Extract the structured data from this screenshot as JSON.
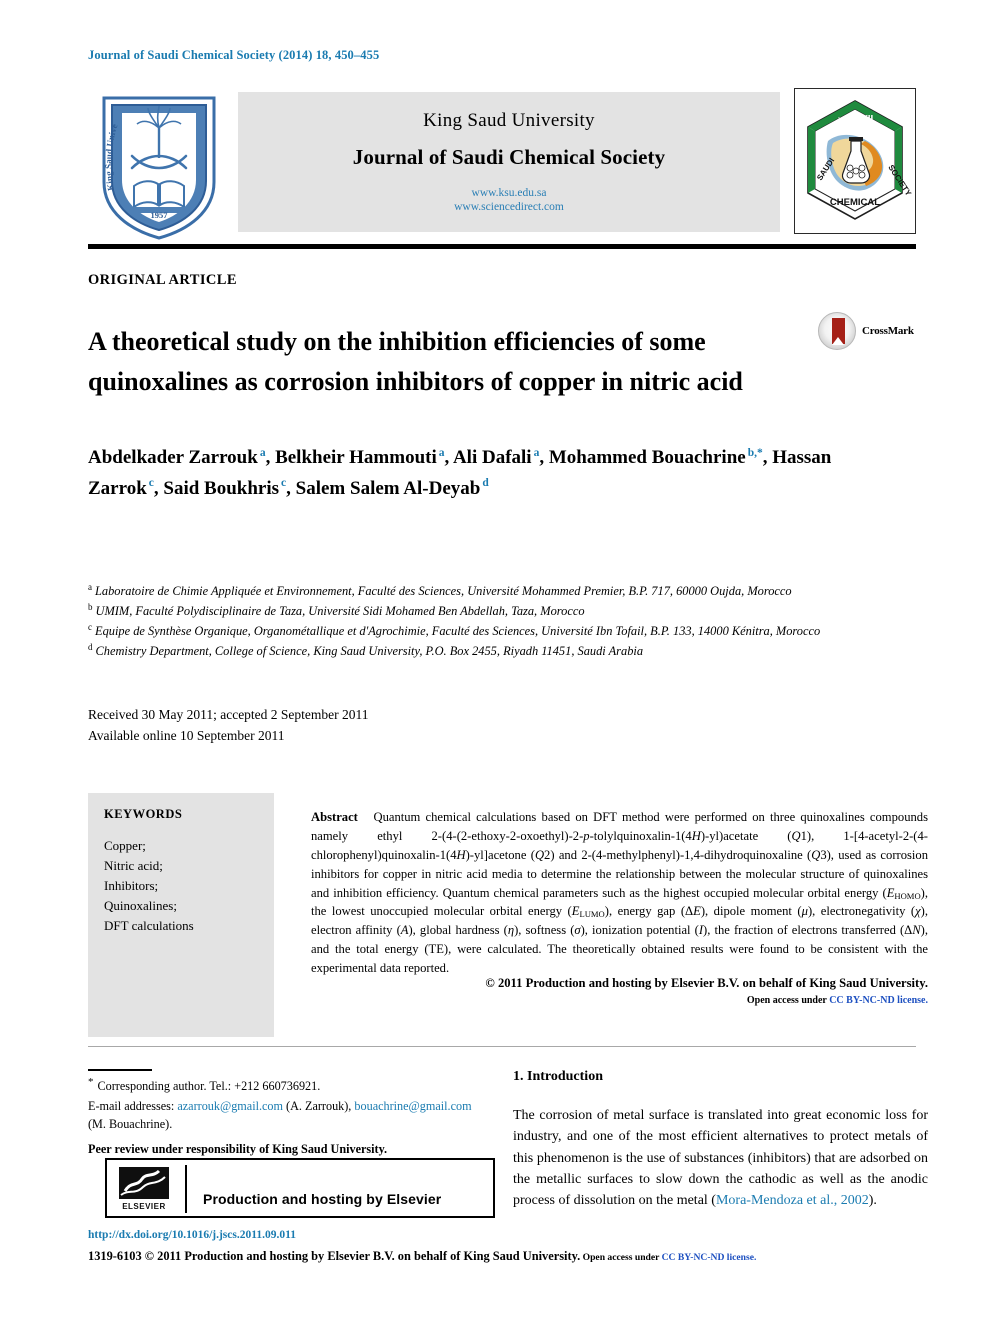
{
  "running_head": "Journal of Saudi Chemical Society (2014) 18, 450–455",
  "masthead": {
    "university": "King Saud University",
    "journal_title": "Journal of Saudi Chemical Society",
    "link_ksu": "www.ksu.edu.sa",
    "link_sciencedirect": "www.sciencedirect.com",
    "ksu_logo_alt": "King Saud University shield emblem 1957",
    "scs_logo_alt": "Saudi Chemical Society hexagon emblem"
  },
  "article": {
    "kicker": "ORIGINAL ARTICLE",
    "title": "A theoretical study on the inhibition efficiencies of some quinoxalines as corrosion inhibitors of copper in nitric acid",
    "crossmark_label": "CrossMark"
  },
  "authors": [
    {
      "name": "Abdelkader Zarrouk",
      "marks": "a",
      "sep": ", "
    },
    {
      "name": "Belkheir Hammouti",
      "marks": "a",
      "sep": ", "
    },
    {
      "name": "Ali Dafali",
      "marks": "a",
      "sep": ", "
    },
    {
      "name": "Mohammed Bouachrine",
      "marks": "b,*",
      "sep": ", "
    },
    {
      "name": "Hassan Zarrok",
      "marks": "c",
      "sep": ", "
    },
    {
      "name": "Said Boukhris",
      "marks": "c",
      "sep": ", "
    },
    {
      "name": "Salem Salem Al-Deyab",
      "marks": "d",
      "sep": ""
    }
  ],
  "affiliations": [
    {
      "mark": "a",
      "text": "Laboratoire de Chimie Appliquée et Environnement, Faculté des Sciences, Université Mohammed Premier, B.P. 717, 60000 Oujda, Morocco"
    },
    {
      "mark": "b",
      "text": "UMIM, Faculté Polydisciplinaire de Taza, Université Sidi Mohamed Ben Abdellah, Taza, Morocco"
    },
    {
      "mark": "c",
      "text": "Equipe de Synthèse Organique, Organométallique et d'Agrochimie, Faculté des Sciences, Université Ibn Tofail, B.P. 133, 14000 Kénitra, Morocco"
    },
    {
      "mark": "d",
      "text": "Chemistry Department, College of Science, King Saud University, P.O. Box 2455, Riyadh 11451, Saudi Arabia"
    }
  ],
  "dates": {
    "received": "Received 30 May 2011; accepted 2 September 2011",
    "available": "Available online 10 September 2011"
  },
  "keywords": {
    "heading": "KEYWORDS",
    "items": [
      "Copper;",
      "Nitric acid;",
      "Inhibitors;",
      "Quinoxalines;",
      "DFT calculations"
    ]
  },
  "abstract": {
    "label": "Abstract",
    "body_html": "Quantum chemical calculations based on DFT method were performed on three quinoxalines compounds namely ethyl 2-(4-(2-ethoxy-2-oxoethyl)-2-<i>p</i>-tolylquinoxalin-1(4<i>H</i>)-yl)acetate (<i>Q</i>1), 1-[4-acetyl-2-(4-chlorophenyl)quinoxalin-1(4<i>H</i>)-yl]acetone (<i>Q</i>2) and 2-(4-methylphenyl)-1,4-dihydroquinoxaline (<i>Q</i>3), used as corrosion inhibitors for copper in nitric acid media to determine the relationship between the molecular structure of quinoxalines and inhibition efficiency. Quantum chemical parameters such as the highest occupied molecular orbital energy (<i>E</i><sub>HOMO</sub>), the lowest unoccupied molecular orbital energy (<i>E</i><sub>LUMO</sub>), energy gap (Δ<i>E</i>), dipole moment (<i>μ</i>), electronegativity (<i>χ</i>), electron affinity (<i>A</i>), global hardness (<i>η</i>), softness (<i>σ</i>), ionization potential (<i>I</i>), the fraction of electrons transferred (Δ<i>N</i>), and the total energy (TE), were calculated. The theoretically obtained results were found to be consistent with the experimental data reported.",
    "copyright": "© 2011 Production and hosting by Elsevier B.V. on behalf of King Saud University.",
    "open_access_prefix": "Open access under ",
    "open_access_link": "CC BY-NC-ND license."
  },
  "footnotes": {
    "corresponding": "Corresponding author. Tel.: +212 660736921.",
    "email_prefix": "E-mail addresses: ",
    "email_1": "azarrouk@gmail.com",
    "email_1_name": " (A. Zarrouk), ",
    "email_2": "bouachrine@gmail.com",
    "email_2_name": " (M. Bouachrine).",
    "peer_review": "Peer review under responsibility of King Saud University."
  },
  "elsevier_box": {
    "text": "Production and hosting by Elsevier",
    "logo_label": "ELSEVIER"
  },
  "footer": {
    "doi": "http://dx.doi.org/10.1016/j.jscs.2011.09.011",
    "issn_line": "1319-6103 © 2011 Production and hosting by Elsevier B.V. on behalf of King Saud University.",
    "open_access_prefix": " Open access under ",
    "open_access_link": "CC BY-NC-ND license."
  },
  "introduction": {
    "heading": "1. Introduction",
    "paragraph_prefix": "The corrosion of metal surface is translated into great economic loss for industry, and one of the most efficient alternatives to protect metals of this phenomenon is the use of substances (inhibitors) that are adsorbed on the metallic surfaces to slow down the cathodic as well as the anodic process of dissolution on the metal (",
    "citation": "Mora-Mendoza et al., 2002",
    "paragraph_suffix": ")."
  },
  "colors": {
    "link_blue": "#1a7bb0",
    "license_blue": "#1c4fc0",
    "band_gray": "#e3e3e3",
    "crossmark_red": "#a52017"
  }
}
